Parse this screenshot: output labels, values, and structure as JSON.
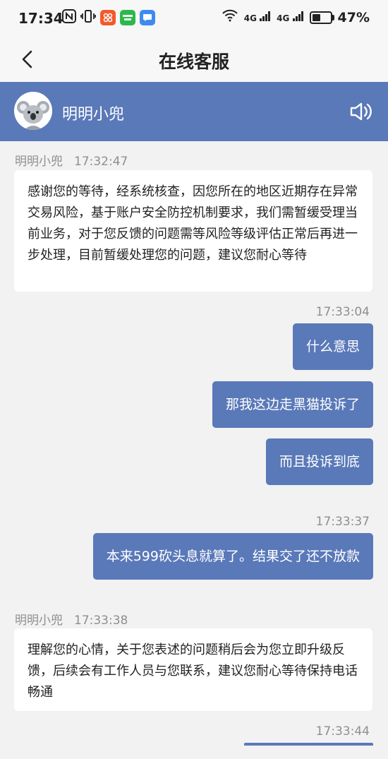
{
  "status_bar": {
    "time": "17:34",
    "notif_icons": [
      "nfc-icon",
      "vibrate-icon",
      "app-icon-orange",
      "app-icon-iqiyi",
      "app-icon-chat"
    ],
    "network_1": "4G",
    "network_2": "4G",
    "battery": "47%",
    "battery_level": 0.47
  },
  "nav": {
    "title": "在线客服"
  },
  "agent": {
    "name": "明明小兜"
  },
  "messages": [
    {
      "side": "left",
      "sender": "明明小兜",
      "time": "17:32:47",
      "text": "感谢您的等待，经系统核查，因您所在的地区近期存在异常交易风险，基于账户安全防控机制要求，我们需暂缓受理当前业务，对于您反馈的问题需等风险等级评估正常后再进一步处理，目前暂缓处理您的问题，建议您耐心等待"
    },
    {
      "side": "right",
      "time": "17:33:04",
      "text": "什么意思"
    },
    {
      "side": "right",
      "text": "那我这边走黑猫投诉了"
    },
    {
      "side": "right",
      "text": "而且投诉到底"
    },
    {
      "side": "right",
      "time": "17:33:37",
      "text": "本来599砍头息就算了。结果交了还不放款"
    },
    {
      "side": "left",
      "sender": "明明小兜",
      "time": "17:33:38",
      "text": "理解您的心情，关于您表述的问题稍后会为您立即升级反馈，后续会有工作人员与您联系，建议您耐心等待保持电话畅通"
    },
    {
      "side": "right",
      "time": "17:33:44",
      "text": ""
    }
  ],
  "colors": {
    "accent": "#5a79b9",
    "background": "#f2f2f2"
  }
}
